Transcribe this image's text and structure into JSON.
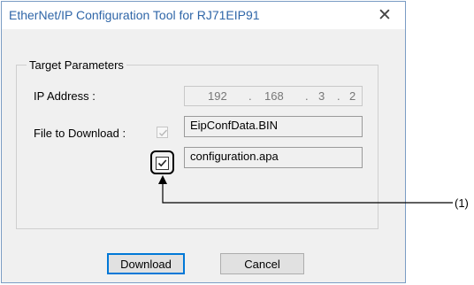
{
  "window": {
    "title": "EtherNet/IP Configuration Tool for RJ71EIP91",
    "close_glyph": "✕"
  },
  "group": {
    "label": "Target Parameters"
  },
  "ip": {
    "label": "IP Address :",
    "octets": [
      "192",
      "168",
      "3",
      "2"
    ],
    "dot": "."
  },
  "files": {
    "label": "File to Download :",
    "file1": "EipConfData.BIN",
    "file2": "configuration.apa",
    "file1_checked": true,
    "file2_checked": true
  },
  "buttons": {
    "download": "Download",
    "cancel": "Cancel"
  },
  "callout": {
    "label": "(1)"
  }
}
